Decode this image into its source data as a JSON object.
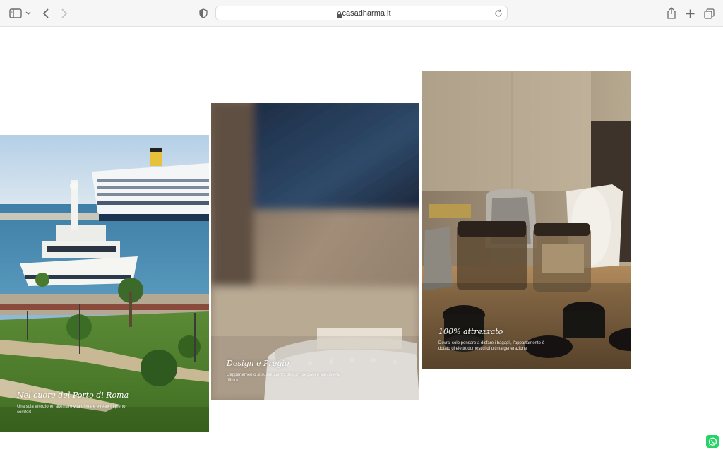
{
  "browser": {
    "url_host": "casadharma.it",
    "icons": {
      "sidebar": "sidebar-icon",
      "caret": "chevron-down-icon",
      "back": "back-icon",
      "forward": "forward-icon",
      "privacy": "privacy-shield-icon",
      "lock": "lock-icon",
      "reload": "reload-icon",
      "share": "share-icon",
      "new_tab": "plus-icon",
      "tabs": "tabs-overview-icon"
    }
  },
  "cards": [
    {
      "title": "Nel cuore del Porto di Roma",
      "text": "Una sola emozione: alternare vita di mare e relax in pieno comfort",
      "image": "cruise-ship-port-photo"
    },
    {
      "title": "Design e Pregio",
      "text": "L'appartamento si sussegue tra design pregiato e atmosfera rifinita",
      "image": "towel-bedroom-photo"
    },
    {
      "title": "100% attrezzato",
      "text": "Dovrai solo pensare a disfare i bagagli, l'appartamento è dotato di elettrodomestici di ultima generazione",
      "image": "kitchen-counter-photo"
    }
  ],
  "floating": {
    "icon": "whatsapp-icon"
  },
  "colors": {
    "whatsapp": "#25d366",
    "toolbar": "#f6f6f6"
  }
}
